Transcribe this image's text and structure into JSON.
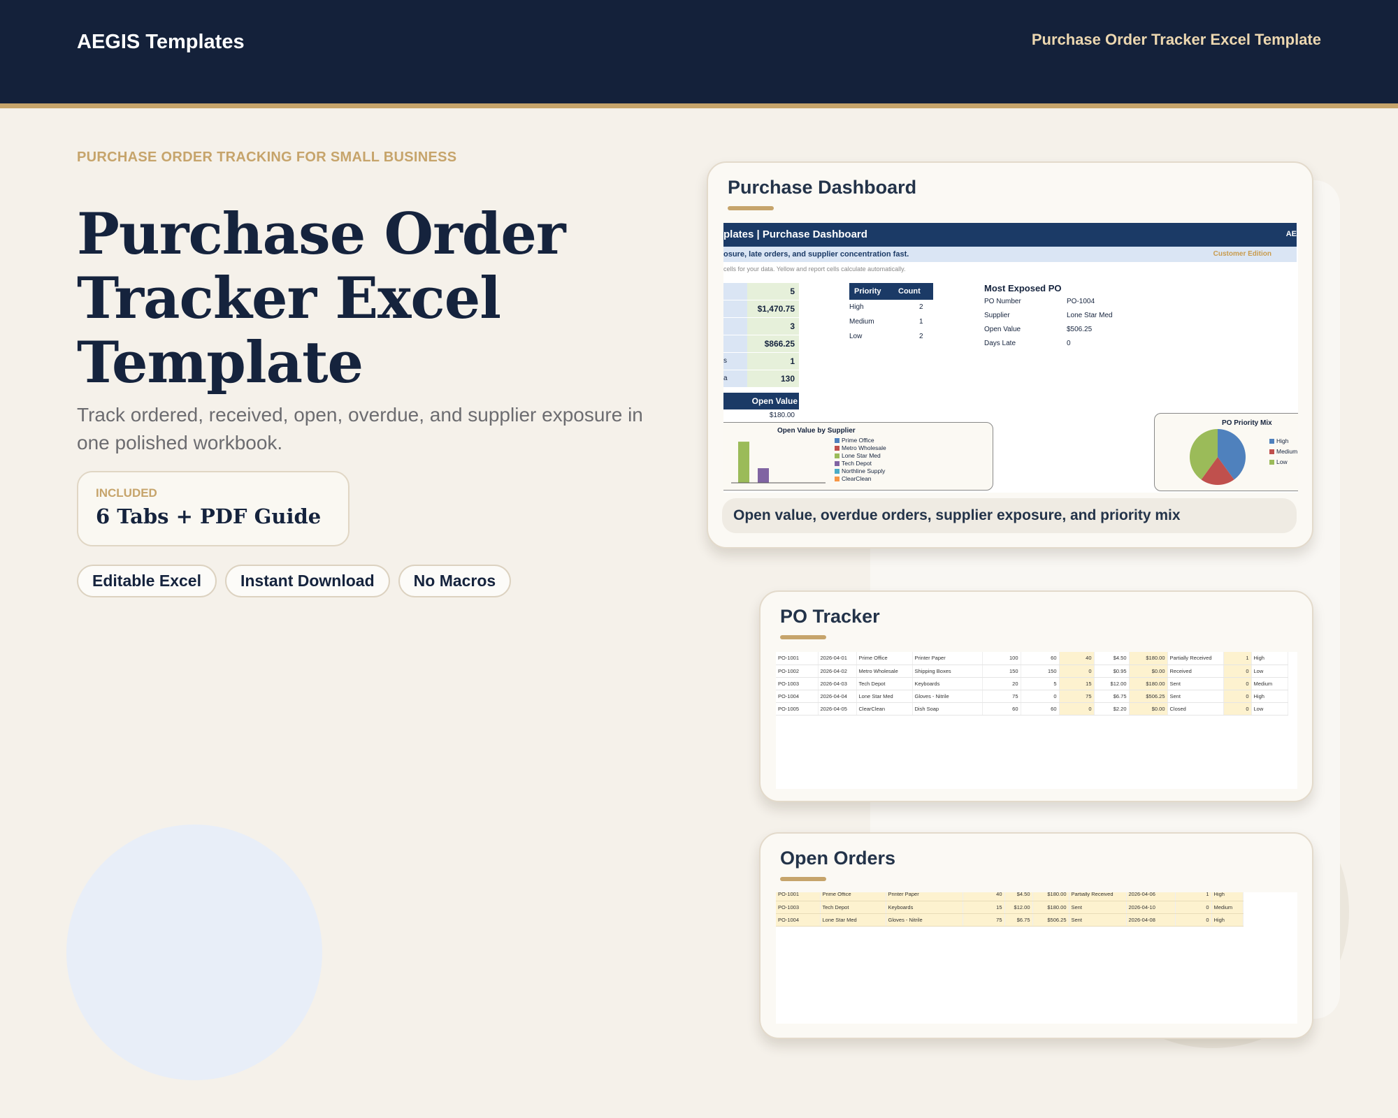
{
  "header": {
    "brand": "AEGIS Templates",
    "title": "Purchase Order Tracker Excel Template"
  },
  "hero": {
    "kicker": "PURCHASE ORDER TRACKING FOR SMALL BUSINESS",
    "title_lines": [
      "Purchase Order",
      "Tracker Excel",
      "Template"
    ],
    "subtitle": "Track ordered, received, open, overdue, and supplier exposure in one polished workbook.",
    "included_label": "INCLUDED",
    "included_value": "6 Tabs + PDF Guide",
    "tags": [
      "Editable Excel",
      "Instant Download",
      "No Macros"
    ]
  },
  "colors": {
    "navy": "#14213a",
    "gold": "#c6a46b",
    "cream": "#f5f1ea",
    "sheet_header": "#1b3a66",
    "highlight": "#fdf2cf"
  },
  "dashboard_card": {
    "title": "Purchase Dashboard",
    "banner_left": "plates | Purchase Dashboard",
    "banner_right": "AE",
    "strip_text": "osure, late orders, and supplier concentration fast.",
    "strip_right": "Customer Edition",
    "note": "cells for your data. Yellow and report cells calculate automatically.",
    "kpis": [
      {
        "label": "",
        "value": "5"
      },
      {
        "label": "",
        "value": "$1,470.75"
      },
      {
        "label": "",
        "value": "3"
      },
      {
        "label": "",
        "value": "$866.25"
      },
      {
        "label": "s",
        "value": "1"
      },
      {
        "label": "a",
        "value": "130"
      }
    ],
    "open_value_header": "Open Value",
    "open_value": "$180.00",
    "priority_table": {
      "headers": [
        "Priority",
        "Count"
      ],
      "rows": [
        [
          "High",
          "2"
        ],
        [
          "Medium",
          "1"
        ],
        [
          "Low",
          "2"
        ]
      ]
    },
    "most_exposed": {
      "title": "Most Exposed PO",
      "rows": [
        [
          "PO Number",
          "PO-1004"
        ],
        [
          "Supplier",
          "Lone Star Med"
        ],
        [
          "Open Value",
          "$506.25"
        ],
        [
          "Days Late",
          "0"
        ]
      ]
    },
    "caption": "Open value, overdue orders, supplier exposure, and priority mix"
  },
  "chart_data": [
    {
      "type": "bar",
      "title": "Open Value by Supplier",
      "categories": [
        "Prime Office",
        "Metro Wholesale",
        "Lone Star Med",
        "Tech Depot",
        "Northline Supply",
        "ClearClean"
      ],
      "values": [
        506.25,
        180,
        0,
        0,
        0,
        0
      ],
      "colors": [
        "#9bbb59",
        "#8064a2",
        "#4f81bd",
        "#4f81bd",
        "#4f81bd",
        "#4f81bd"
      ],
      "legend_colors": [
        "#4f81bd",
        "#c0504d",
        "#9bbb59",
        "#8064a2",
        "#4bacc6",
        "#f79646"
      ],
      "ylim": [
        0,
        550
      ]
    },
    {
      "type": "pie",
      "title": "PO Priority Mix",
      "labels": [
        "High",
        "Medium",
        "Low"
      ],
      "values": [
        2,
        1,
        2
      ],
      "colors": [
        "#4f81bd",
        "#c0504d",
        "#9bbb59"
      ]
    }
  ],
  "tracker_card": {
    "title": "PO Tracker",
    "rows": [
      [
        "PO-1001",
        "2026-04-01",
        "Prime Office",
        "Printer Paper",
        "100",
        "60",
        "40",
        "$4.50",
        "$180.00",
        "Partially Received",
        "1",
        "High"
      ],
      [
        "PO-1002",
        "2026-04-02",
        "Metro Wholesale",
        "Shipping Boxes",
        "150",
        "150",
        "0",
        "$0.95",
        "$0.00",
        "Received",
        "0",
        "Low"
      ],
      [
        "PO-1003",
        "2026-04-03",
        "Tech Depot",
        "Keyboards",
        "20",
        "5",
        "15",
        "$12.00",
        "$180.00",
        "Sent",
        "0",
        "Medium"
      ],
      [
        "PO-1004",
        "2026-04-04",
        "Lone Star Med",
        "Gloves - Nitrile",
        "75",
        "0",
        "75",
        "$6.75",
        "$506.25",
        "Sent",
        "0",
        "High"
      ],
      [
        "PO-1005",
        "2026-04-05",
        "ClearClean",
        "Dish Soap",
        "60",
        "60",
        "0",
        "$2.20",
        "$0.00",
        "Closed",
        "0",
        "Low"
      ]
    ]
  },
  "open_orders_card": {
    "title": "Open Orders",
    "rows": [
      [
        "PO-1001",
        "Prime Office",
        "Printer Paper",
        "40",
        "$4.50",
        "$180.00",
        "Partially Received",
        "2026-04-06",
        "1",
        "High"
      ],
      [
        "PO-1003",
        "Tech Depot",
        "Keyboards",
        "15",
        "$12.00",
        "$180.00",
        "Sent",
        "2026-04-10",
        "0",
        "Medium"
      ],
      [
        "PO-1004",
        "Lone Star Med",
        "Gloves - Nitrile",
        "75",
        "$6.75",
        "$506.25",
        "Sent",
        "2026-04-08",
        "0",
        "High"
      ]
    ]
  }
}
